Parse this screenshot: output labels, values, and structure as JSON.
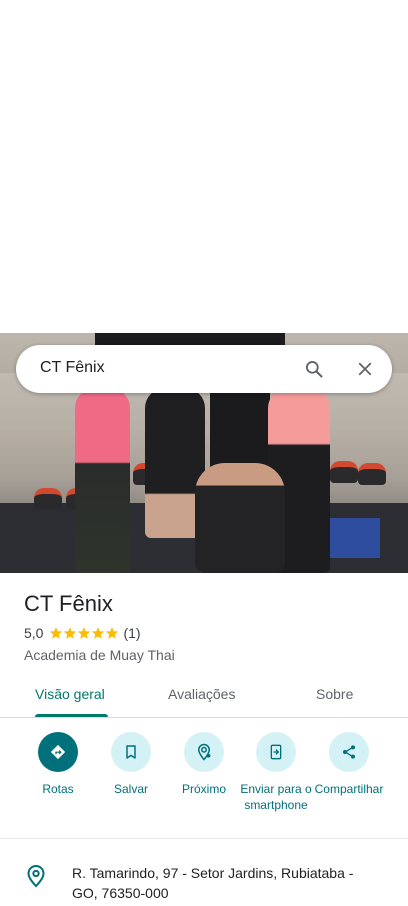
{
  "search": {
    "query": "CT Fênix"
  },
  "place": {
    "name": "CT Fênix",
    "rating": "5,0",
    "rating_stars": 5,
    "review_count": "(1)",
    "category": "Academia de Muay Thai",
    "address": "R. Tamarindo, 97 - Setor Jardins, Rubiataba - GO, 76350-000"
  },
  "tabs": [
    {
      "label": "Visão geral",
      "active": true
    },
    {
      "label": "Avaliações",
      "active": false
    },
    {
      "label": "Sobre",
      "active": false
    }
  ],
  "actions": [
    {
      "label": "Rotas",
      "icon": "directions-icon"
    },
    {
      "label": "Salvar",
      "icon": "bookmark-icon"
    },
    {
      "label": "Próximo",
      "icon": "nearby-icon"
    },
    {
      "label": "Enviar para o smartphone",
      "icon": "send-to-phone-icon"
    },
    {
      "label": "Compartilhar",
      "icon": "share-icon"
    }
  ],
  "colors": {
    "accent": "#00707a",
    "tab_active": "#00796b",
    "star": "#fbbc04",
    "action_bg": "#d4f1f5"
  }
}
